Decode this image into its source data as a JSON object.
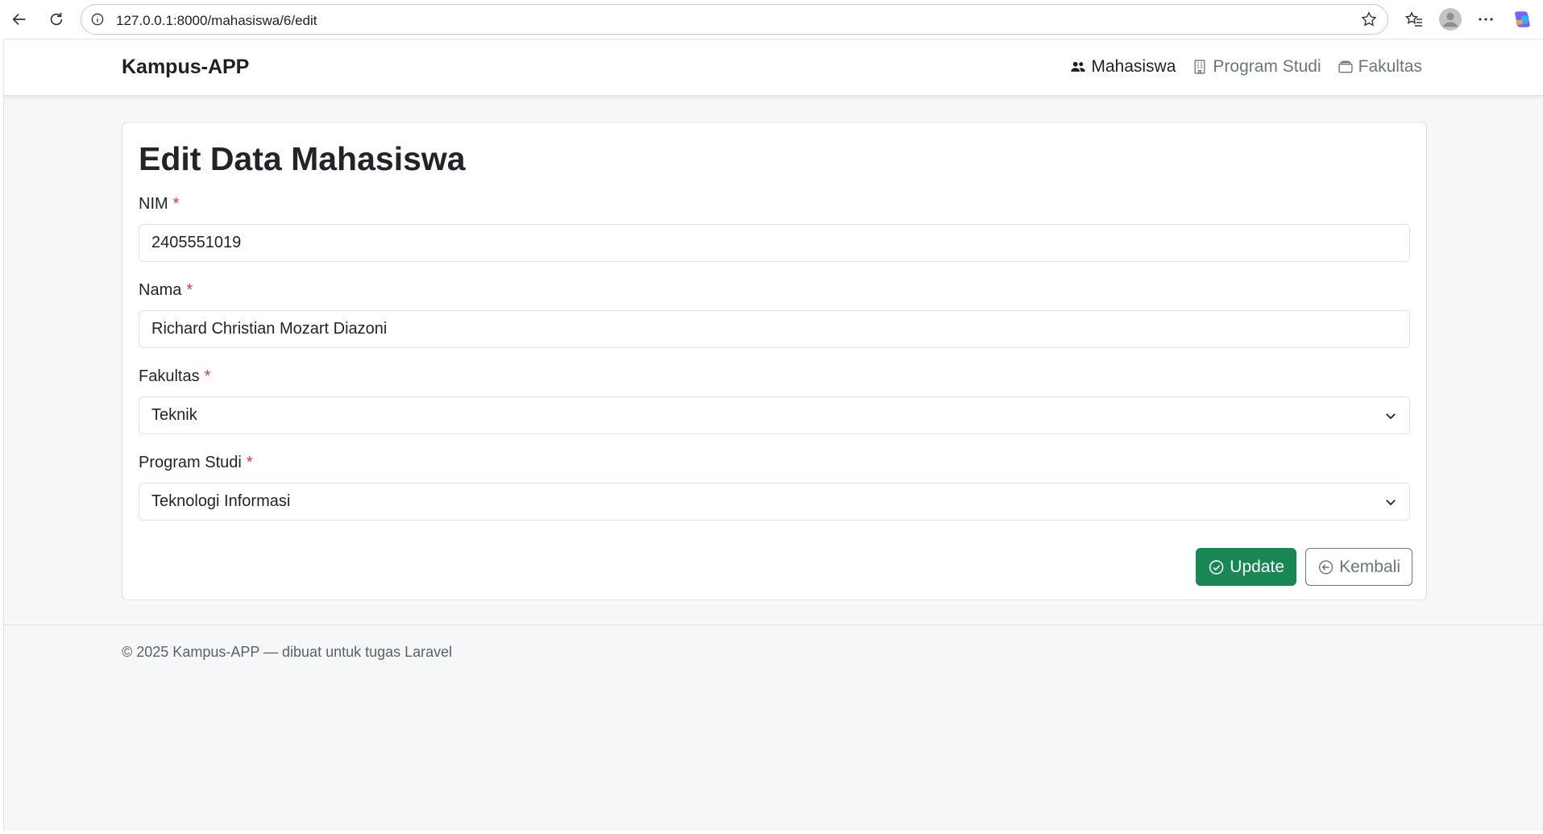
{
  "browser": {
    "url": "127.0.0.1:8000/mahasiswa/6/edit",
    "icons": [
      "back-icon",
      "refresh-icon",
      "site-info-icon",
      "favorite-star-icon",
      "favorites-icon",
      "profile-icon",
      "more-icon",
      "copilot-icon"
    ]
  },
  "navbar": {
    "brand": "Kampus-APP",
    "links": [
      {
        "label": "Mahasiswa",
        "icon": "people-icon",
        "active": true
      },
      {
        "label": "Program Studi",
        "icon": "building-icon",
        "active": false
      },
      {
        "label": "Fakultas",
        "icon": "briefcase-icon",
        "active": false
      }
    ]
  },
  "form": {
    "title": "Edit Data Mahasiswa",
    "required_mark": "*",
    "fields": [
      {
        "label": "NIM",
        "value": "2405551019",
        "type": "text"
      },
      {
        "label": "Nama",
        "value": "Richard Christian Mozart Diazoni",
        "type": "text"
      },
      {
        "label": "Fakultas",
        "value": "Teknik",
        "type": "select"
      },
      {
        "label": "Program Studi",
        "value": "Teknologi Informasi",
        "type": "select"
      }
    ],
    "buttons": {
      "update": "Update",
      "back": "Kembali"
    }
  },
  "footer": {
    "text": "© 2025 Kampus-APP — dibuat untuk tugas Laravel"
  },
  "colors": {
    "success": "#198754",
    "danger": "#dc3545",
    "secondary": "#6c757d",
    "page_bg": "#f6f7f9"
  }
}
